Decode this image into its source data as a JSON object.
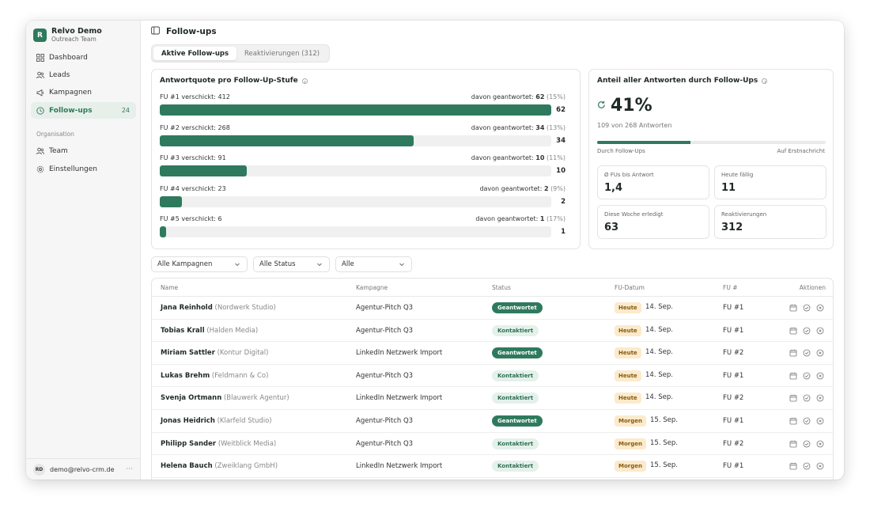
{
  "brand": {
    "logo_letter": "R",
    "name": "Relvo Demo",
    "subtitle": "Outreach Team"
  },
  "nav": [
    {
      "label": "Dashboard",
      "icon": "grid-icon"
    },
    {
      "label": "Leads",
      "icon": "users-icon"
    },
    {
      "label": "Kampagnen",
      "icon": "megaphone-icon"
    },
    {
      "label": "Follow-ups",
      "icon": "clock-icon",
      "count": "24",
      "active": true
    }
  ],
  "org_section": {
    "label": "Organisation",
    "items": [
      {
        "label": "Team",
        "icon": "users-icon"
      },
      {
        "label": "Einstellungen",
        "icon": "gear-icon"
      }
    ]
  },
  "user": {
    "initials": "RD",
    "email": "demo@relvo-crm.de",
    "more": "···"
  },
  "header": {
    "title": "Follow-ups"
  },
  "tabs": [
    {
      "label": "Aktive Follow-ups",
      "active": true
    },
    {
      "label": "Reaktivierungen (312)",
      "active": false
    }
  ],
  "rate_card": {
    "title": "Antwortquote pro Follow-Up-Stufe",
    "rows": [
      {
        "label": "FU #1 verschickt: 412",
        "answered_prefix": "davon geantwortet:",
        "answered": "62",
        "pct": "(15%)",
        "value": "62",
        "fill": 1.0
      },
      {
        "label": "FU #2 verschickt: 268",
        "answered_prefix": "davon geantwortet:",
        "answered": "34",
        "pct": "(13%)",
        "value": "34",
        "fill": 0.648
      },
      {
        "label": "FU #3 verschickt: 91",
        "answered_prefix": "davon geantwortet:",
        "answered": "10",
        "pct": "(11%)",
        "value": "10",
        "fill": 0.222
      },
      {
        "label": "FU #4 verschickt: 23",
        "answered_prefix": "davon geantwortet:",
        "answered": "2",
        "pct": "(9%)",
        "value": "2",
        "fill": 0.057
      },
      {
        "label": "FU #5 verschickt: 6",
        "answered_prefix": "davon geantwortet:",
        "answered": "1",
        "pct": "(17%)",
        "value": "1",
        "fill": 0.016
      }
    ]
  },
  "share_card": {
    "title": "Anteil aller Antworten durch Follow-Ups",
    "percent": "41%",
    "subline": "109 von 268 Antworten",
    "share_fraction": 0.41,
    "left_label": "Durch Follow-Ups",
    "right_label": "Auf Erstnachricht",
    "stats": [
      {
        "label": "Ø FUs bis Antwort",
        "value": "1,4"
      },
      {
        "label": "Heute fällig",
        "value": "11"
      },
      {
        "label": "Diese Woche erledigt",
        "value": "63"
      },
      {
        "label": "Reaktivierungen",
        "value": "312"
      }
    ]
  },
  "filters": [
    {
      "value": "Alle Kampagnen"
    },
    {
      "value": "Alle Status"
    },
    {
      "value": "Alle"
    }
  ],
  "table": {
    "headers": {
      "name": "Name",
      "campaign": "Kampagne",
      "status": "Status",
      "date": "FU-Datum",
      "fu": "FU #",
      "actions": "Aktionen"
    },
    "rows": [
      {
        "name": "Jana Reinhold",
        "company": "(Nordwerk Studio)",
        "campaign": "Agentur-Pitch Q3",
        "status": "Geantwortet",
        "due": "Heute",
        "date": "14. Sep.",
        "fu": "FU #1"
      },
      {
        "name": "Tobias Krall",
        "company": "(Halden Media)",
        "campaign": "Agentur-Pitch Q3",
        "status": "Kontaktiert",
        "due": "Heute",
        "date": "14. Sep.",
        "fu": "FU #1"
      },
      {
        "name": "Miriam Sattler",
        "company": "(Kontur Digital)",
        "campaign": "LinkedIn Netzwerk Import",
        "status": "Geantwortet",
        "due": "Heute",
        "date": "14. Sep.",
        "fu": "FU #2"
      },
      {
        "name": "Lukas Brehm",
        "company": "(Feldmann & Co)",
        "campaign": "Agentur-Pitch Q3",
        "status": "Kontaktiert",
        "due": "Heute",
        "date": "14. Sep.",
        "fu": "FU #1"
      },
      {
        "name": "Svenja Ortmann",
        "company": "(Blauwerk Agentur)",
        "campaign": "LinkedIn Netzwerk Import",
        "status": "Kontaktiert",
        "due": "Heute",
        "date": "14. Sep.",
        "fu": "FU #2"
      },
      {
        "name": "Jonas Heidrich",
        "company": "(Klarfeld Studio)",
        "campaign": "Agentur-Pitch Q3",
        "status": "Geantwortet",
        "due": "Morgen",
        "date": "15. Sep.",
        "fu": "FU #1"
      },
      {
        "name": "Philipp Sander",
        "company": "(Weitblick Media)",
        "campaign": "Agentur-Pitch Q3",
        "status": "Kontaktiert",
        "due": "Morgen",
        "date": "15. Sep.",
        "fu": "FU #2"
      },
      {
        "name": "Helena Bauch",
        "company": "(Zweiklang GmbH)",
        "campaign": "LinkedIn Netzwerk Import",
        "status": "Kontaktiert",
        "due": "Morgen",
        "date": "15. Sep.",
        "fu": "FU #1"
      }
    ]
  },
  "colors": {
    "accent": "#2f7a5e",
    "accent_light": "#e4f1ea",
    "due_bg": "#fbeacb",
    "due_text": "#8a5a10"
  }
}
